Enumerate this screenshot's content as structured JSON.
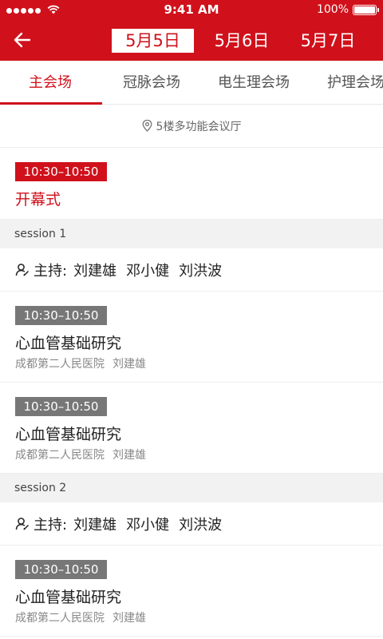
{
  "status_bar": {
    "time": "9:41 AM",
    "battery": "100%"
  },
  "header": {
    "date_tabs": [
      "5月5日",
      "5月6日",
      "5月7日"
    ],
    "active_date_index": 0
  },
  "venue_tabs": {
    "items": [
      "主会场",
      "冠脉会场",
      "电生理会场",
      "护理会场"
    ],
    "active_index": 0
  },
  "location": "5楼多功能会议厅",
  "opening": {
    "time": "10:30–10:50",
    "title": "开幕式"
  },
  "sessions": [
    {
      "name": "session 1",
      "host_label": "主持:",
      "hosts": [
        "刘建雄",
        "邓小健",
        "刘洪波"
      ],
      "talks": [
        {
          "time": "10:30–10:50",
          "title": "心血管基础研究",
          "hospital": "成都第二人民医院",
          "speaker": "刘建雄"
        },
        {
          "time": "10:30–10:50",
          "title": "心血管基础研究",
          "hospital": "成都第二人民医院",
          "speaker": "刘建雄"
        }
      ]
    },
    {
      "name": "session 2",
      "host_label": "主持:",
      "hosts": [
        "刘建雄",
        "邓小健",
        "刘洪波"
      ],
      "talks": [
        {
          "time": "10:30–10:50",
          "title": "心血管基础研究",
          "hospital": "成都第二人民医院",
          "speaker": "刘建雄"
        }
      ]
    }
  ],
  "colors": {
    "brand_red": "#d0111b",
    "badge_gray": "#777777",
    "section_bg": "#f2f2f2"
  }
}
